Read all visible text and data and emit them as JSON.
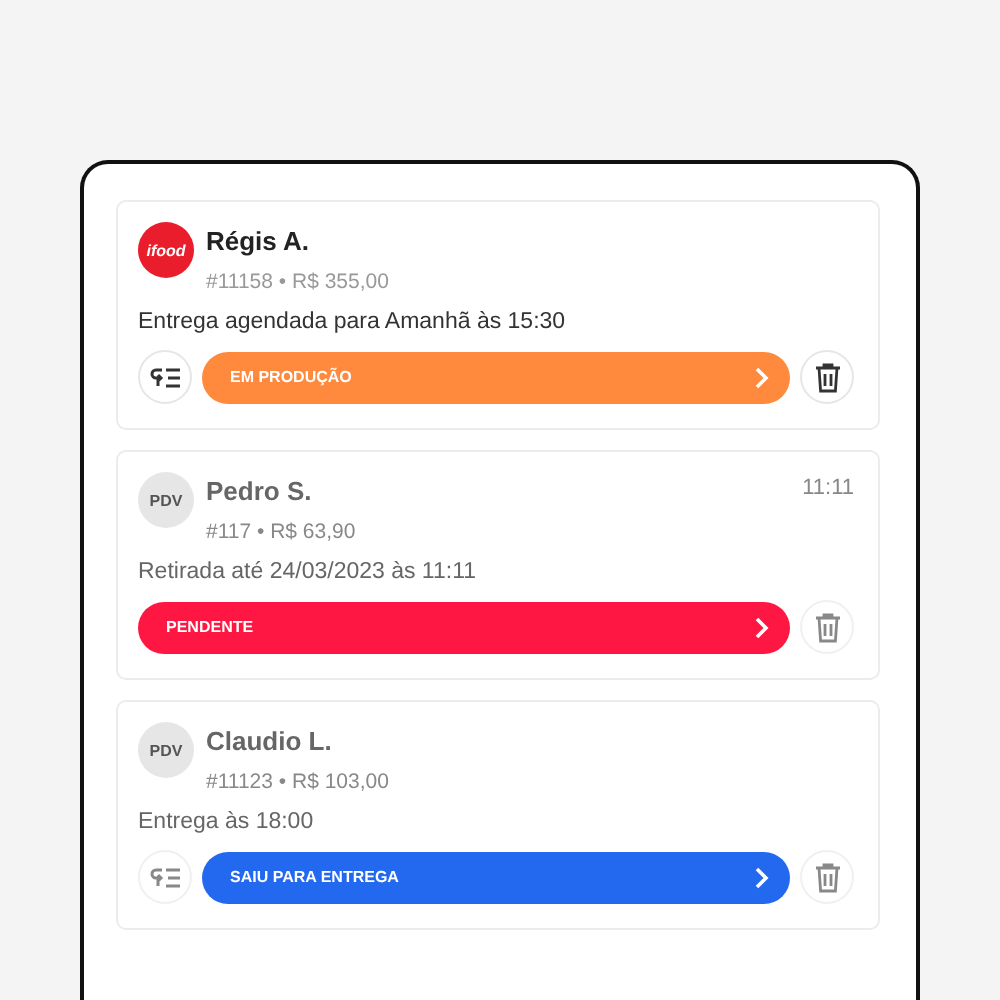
{
  "orders": [
    {
      "avatar": {
        "kind": "ifood",
        "text": "ifood"
      },
      "name": "Régis A.",
      "order": "#11158 • R$ 355,00",
      "info": "Entrega agendada para Amanhã às 15:30",
      "status": {
        "label": "EM PRODUÇÃO",
        "color": "#ff8a3d"
      },
      "list_button": true,
      "dimmed": false
    },
    {
      "avatar": {
        "kind": "pdv",
        "text": "PDV"
      },
      "name": "Pedro S.",
      "time": "11:11",
      "order": "#117 • R$ 63,90",
      "info": "Retirada até 24/03/2023 às 11:11",
      "status": {
        "label": "PENDENTE",
        "color": "#ff1744"
      },
      "list_button": false,
      "dimmed": true
    },
    {
      "avatar": {
        "kind": "pdv",
        "text": "PDV"
      },
      "name": "Claudio L.",
      "order": "#11123 • R$ 103,00",
      "info": "Entrega às 18:00",
      "status": {
        "label": "SAIU PARA ENTREGA",
        "color": "#2369f0"
      },
      "list_button": true,
      "dimmed": true
    }
  ]
}
